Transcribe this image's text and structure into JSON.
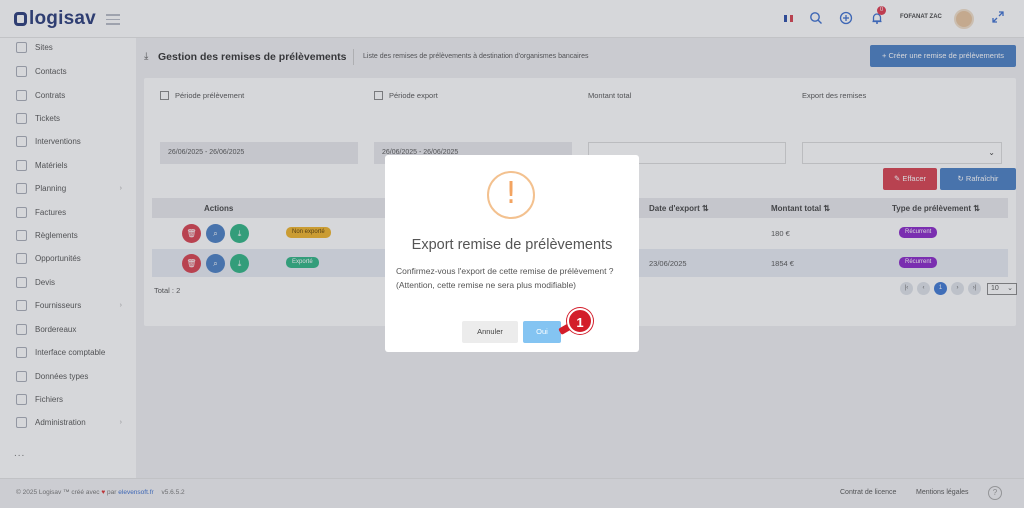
{
  "app": {
    "brand": "logisav"
  },
  "topbar": {
    "notification_count": "0",
    "username": "FOFANAT ZAC"
  },
  "sidebar": {
    "items": [
      {
        "label": "Sites"
      },
      {
        "label": "Contacts"
      },
      {
        "label": "Contrats"
      },
      {
        "label": "Tickets"
      },
      {
        "label": "Interventions"
      },
      {
        "label": "Matériels"
      },
      {
        "label": "Planning",
        "has_submenu": true
      },
      {
        "label": "Factures"
      },
      {
        "label": "Règlements"
      },
      {
        "label": "Opportunités"
      },
      {
        "label": "Devis"
      },
      {
        "label": "Fournisseurs",
        "has_submenu": true
      },
      {
        "label": "Bordereaux"
      },
      {
        "label": "Interface comptable"
      },
      {
        "label": "Données types"
      },
      {
        "label": "Fichiers"
      },
      {
        "label": "Administration",
        "has_submenu": true
      }
    ],
    "more": "..."
  },
  "page": {
    "title": "Gestion des remises de prélèvements",
    "subtitle": "Liste des remises de prélèvements à destination d'organismes bancaires",
    "create_button": "+ Créer une remise de prélèvements"
  },
  "filters": {
    "periode_prelevement": {
      "label": "Période prélèvement",
      "value": "26/06/2025 - 26/06/2025"
    },
    "periode_export": {
      "label": "Période export",
      "value": "26/06/2025 - 26/06/2025"
    },
    "montant_total": {
      "label": "Montant total",
      "value": ""
    },
    "export_remises": {
      "label": "Export des remises",
      "value": ""
    },
    "clear_button": "Effacer",
    "refresh_button": "Rafraîchir"
  },
  "table": {
    "headers": {
      "actions": "Actions",
      "date_export": "Date d'export ⇅",
      "montant_total": "Montant total ⇅",
      "type_prelevement": "Type de prélèvement ⇅"
    },
    "rows": [
      {
        "status": "Non exporté",
        "date_export": "",
        "montant": "180 €",
        "type": "Récurrent"
      },
      {
        "status": "Exporté",
        "date_export": "23/06/2025",
        "montant": "1854 €",
        "type": "Récurrent"
      }
    ],
    "total": "Total : 2",
    "pagination": {
      "current_page": "1",
      "page_size": "10"
    }
  },
  "footer": {
    "copyright": "© 2025 Logisav ™ créé avec",
    "by": "par",
    "company": "elevensoft.fr",
    "version": "v5.6.5.2",
    "license": "Contrat de licence",
    "legal": "Mentions légales"
  },
  "modal": {
    "title": "Export remise de prélèvements",
    "message": "Confirmez-vous l'export de cette remise de prélèvement ? (Attention, cette remise ne sera plus modifiable)",
    "cancel_button": "Annuler",
    "confirm_button": "Oui"
  },
  "annotation": {
    "step": "1"
  },
  "colors": {
    "brand": "#2a3c7a",
    "primary": "#4a7fc5",
    "danger": "#d9414f",
    "warning": "#f3a461",
    "confirm": "#84c4f2",
    "status_not_exported": "#f0b429",
    "status_exported": "#2fb585",
    "type_badge": "#8a27c9"
  }
}
